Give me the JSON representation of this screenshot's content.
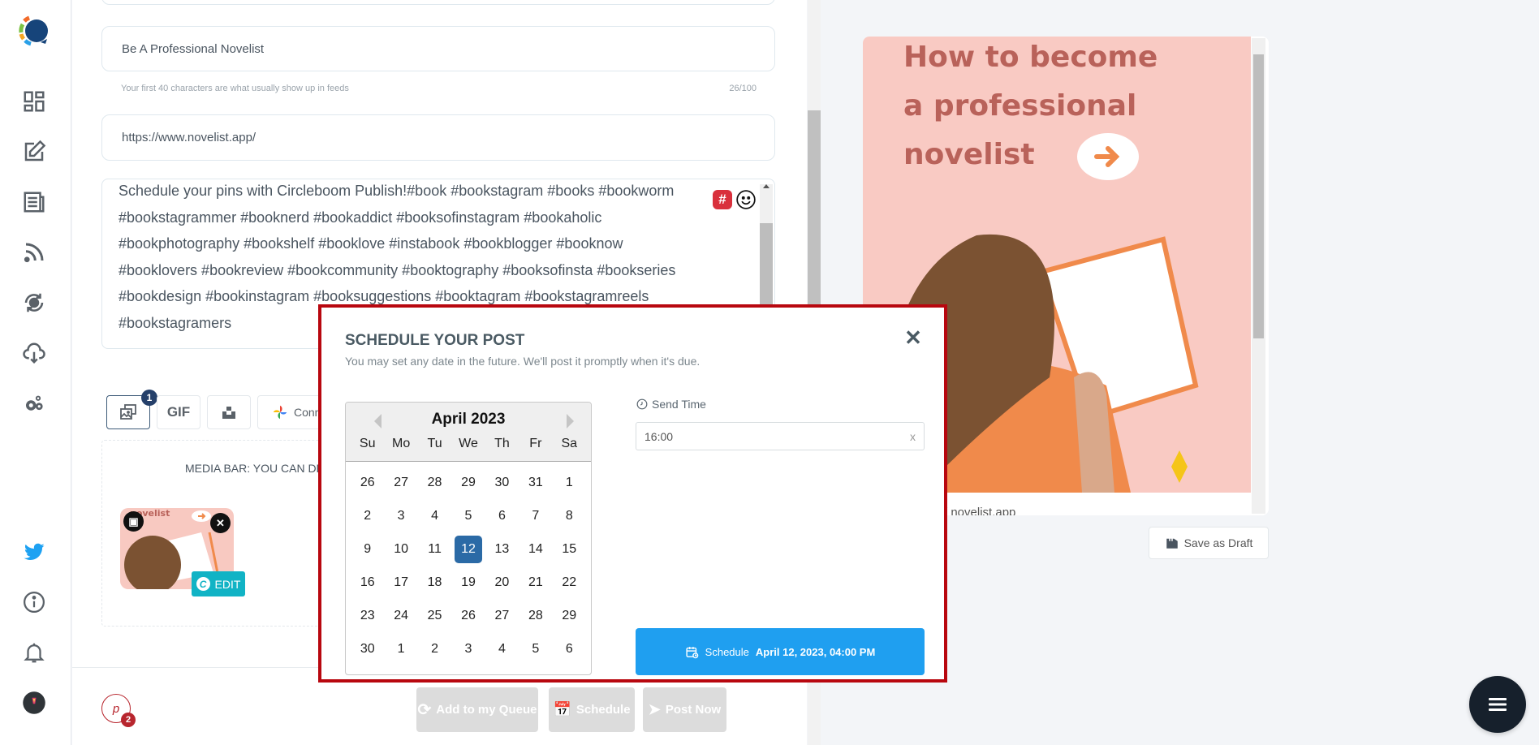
{
  "sidebar": {
    "logo": "circleboom-logo",
    "items": [
      {
        "name": "dashboard",
        "icon": "dashboard-icon"
      },
      {
        "name": "create-post",
        "icon": "edit-icon"
      },
      {
        "name": "articles",
        "icon": "newspaper-icon"
      },
      {
        "name": "rss",
        "icon": "rss-icon"
      },
      {
        "name": "queue",
        "icon": "clock-refresh-icon"
      },
      {
        "name": "cloud",
        "icon": "cloud-download-icon"
      },
      {
        "name": "settings",
        "icon": "gears-icon"
      }
    ],
    "bottom_items": [
      {
        "name": "twitter",
        "icon": "twitter-icon"
      },
      {
        "name": "info",
        "icon": "info-icon"
      },
      {
        "name": "notifications",
        "icon": "bell-icon"
      },
      {
        "name": "profile",
        "icon": "avatar"
      }
    ]
  },
  "editor": {
    "title_value": "Be A Professional Novelist",
    "title_hint": "Your first 40 characters are what usually show up in feeds",
    "title_counter": "26/100",
    "link_value": "https://www.novelist.app/",
    "description": "Schedule your pins with Circleboom Publish!#book #bookstagram #books #bookworm\n#bookstagrammer #booknerd #bookaddict #booksofinstagram #bookaholic\n#bookphotography #bookshelf #booklove #instabook #bookblogger #booknow\n#booklovers #bookreview #bookcommunity #booktography #booksofinsta #bookseries\n#bookdesign #bookinstagram #booksuggestions #booktagram #bookstagramreels\n#bookstagramers",
    "hashtag_icon": "#",
    "media_tools": {
      "image_badge": "1",
      "gif_label": "GIF",
      "connect_label": "Conne"
    },
    "media_bar_title": "MEDIA BAR: YOU CAN DR",
    "thumbnail_text": "novelist",
    "edit_label": "EDIT",
    "edit_icon": "C",
    "account_count": "2",
    "account_icon": "p",
    "footer_buttons": {
      "queue": "Add to my Queue",
      "schedule": "Schedule",
      "post_now": "Post Now"
    }
  },
  "preview": {
    "image_title_lines": [
      "How to become",
      "a professional",
      "novelist"
    ],
    "caption": "/ novelist.app",
    "save_draft": "Save as Draft"
  },
  "modal": {
    "title": "SCHEDULE YOUR POST",
    "subtitle": "You may set any date in the future. We'll post it promptly when it's due.",
    "close": "✕",
    "calendar": {
      "month": "April 2023",
      "weekdays": [
        "Su",
        "Mo",
        "Tu",
        "We",
        "Th",
        "Fr",
        "Sa"
      ],
      "days": [
        "26",
        "27",
        "28",
        "29",
        "30",
        "31",
        "1",
        "2",
        "3",
        "4",
        "5",
        "6",
        "7",
        "8",
        "9",
        "10",
        "11",
        "12",
        "13",
        "14",
        "15",
        "16",
        "17",
        "18",
        "19",
        "20",
        "21",
        "22",
        "23",
        "24",
        "25",
        "26",
        "27",
        "28",
        "29",
        "30",
        "1",
        "2",
        "3",
        "4",
        "5",
        "6"
      ],
      "selected": "12"
    },
    "send_time_label": "Send Time",
    "time_value": "16:00",
    "time_clear": "x",
    "schedule_label": "Schedule",
    "schedule_datetime": "April 12, 2023, 04:00 PM",
    "colors": {
      "border": "#b8070f",
      "selected_day": "#2b6aa6",
      "schedule_button": "#1f9ff0"
    }
  }
}
